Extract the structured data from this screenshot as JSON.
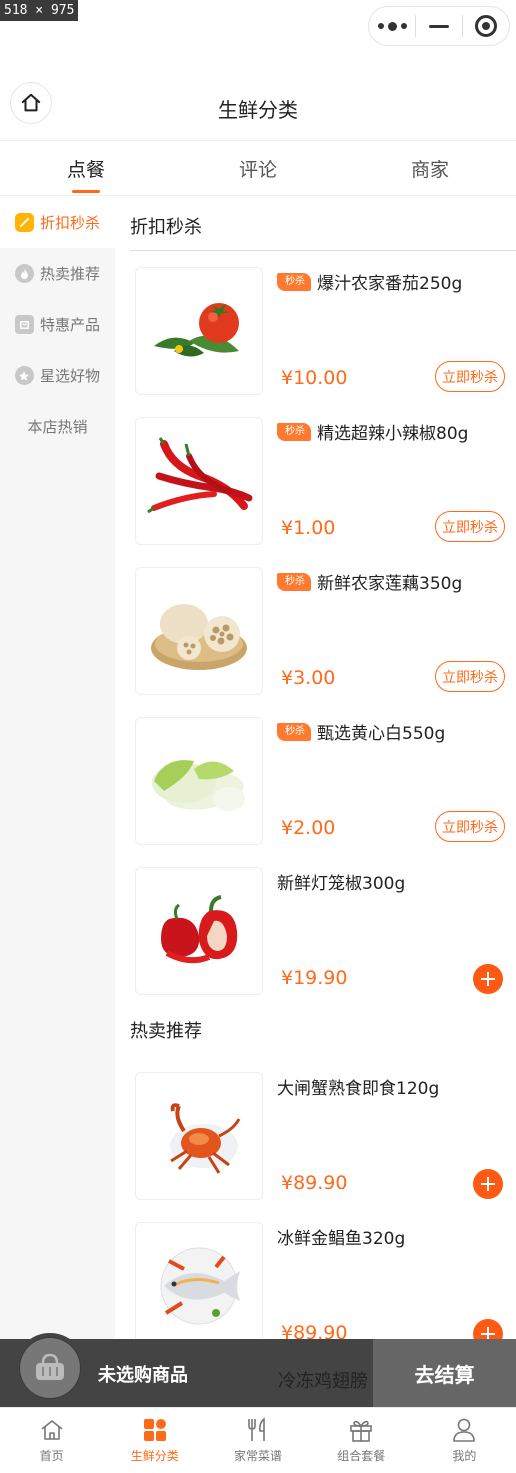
{
  "top_label": "518 × 975",
  "navbar": {
    "title": "生鲜分类"
  },
  "tabs": [
    {
      "label": "点餐"
    },
    {
      "label": "评论"
    },
    {
      "label": "商家"
    }
  ],
  "sidebar": {
    "items": [
      {
        "label": "折扣秒杀",
        "icon": "tag-icon"
      },
      {
        "label": "热卖推荐",
        "icon": "flame-icon"
      },
      {
        "label": "特惠产品",
        "icon": "gift-box-icon"
      },
      {
        "label": "星选好物",
        "icon": "star-icon"
      },
      {
        "label": "本店热销"
      }
    ]
  },
  "sections": [
    {
      "title": "折扣秒杀",
      "products": [
        {
          "tag": "秒杀",
          "name": "爆汁农家番茄250g",
          "price": "¥10.00",
          "action": "立即秒杀",
          "image": "tomato"
        },
        {
          "tag": "秒杀",
          "name": "精选超辣小辣椒80g",
          "price": "¥1.00",
          "action": "立即秒杀",
          "image": "chili"
        },
        {
          "tag": "秒杀",
          "name": "新鲜农家莲藕350g",
          "price": "¥3.00",
          "action": "立即秒杀",
          "image": "lotus-root"
        },
        {
          "tag": "秒杀",
          "name": "甄选黄心白550g",
          "price": "¥2.00",
          "action": "立即秒杀",
          "image": "cabbage"
        },
        {
          "name": "新鲜灯笼椒300g",
          "price": "¥19.90",
          "image": "bell-pepper"
        }
      ]
    },
    {
      "title": "热卖推荐",
      "products": [
        {
          "name": "大闸蟹熟食即食120g",
          "price": "¥89.90",
          "image": "crab"
        },
        {
          "name": "冰鲜金鲳鱼320g",
          "price": "¥89.90",
          "image": "fish"
        }
      ]
    }
  ],
  "cart": {
    "empty_text": "未选购商品",
    "checkout_label": "去结算",
    "peek_text": "冷冻鸡翅膀"
  },
  "tabbar": {
    "items": [
      {
        "label": "首页",
        "icon": "home-icon"
      },
      {
        "label": "生鲜分类",
        "icon": "category-grid-icon",
        "active": true
      },
      {
        "label": "家常菜谱",
        "icon": "cutlery-icon"
      },
      {
        "label": "组合套餐",
        "icon": "gift-icon"
      },
      {
        "label": "我的",
        "icon": "user-icon"
      }
    ]
  },
  "colors": {
    "accent": "#ff6a1a",
    "sidebar_bg": "#f6f6f6",
    "cart_bg": "#444444"
  }
}
